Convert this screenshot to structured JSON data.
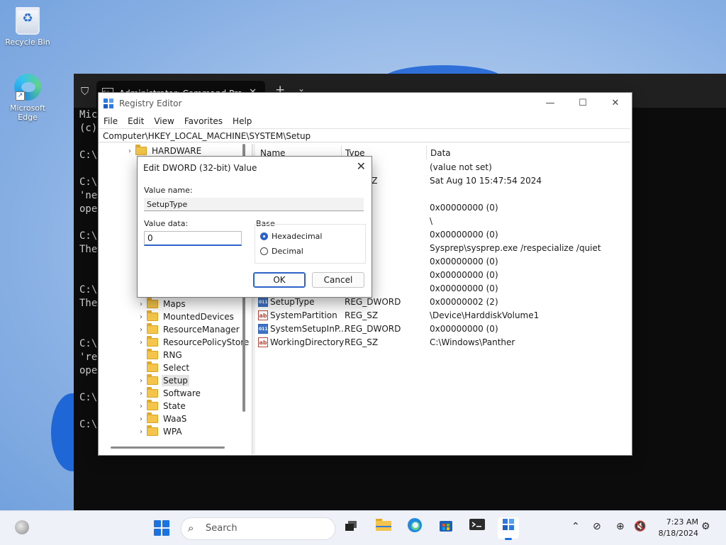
{
  "desktop": {
    "icons": [
      {
        "label": "Recycle Bin"
      },
      {
        "label": "Microsoft Edge"
      }
    ]
  },
  "terminal": {
    "tab_title": "Administrator: Command Pro",
    "lines": [
      {
        "text": "Mic"
      },
      {
        "text": "(c)"
      },
      {
        "text": "C:\\"
      },
      {
        "text": "C:\\"
      },
      {
        "text": "'ne"
      },
      {
        "text": "ope"
      },
      {
        "text": "C:\\"
      },
      {
        "text": "The"
      },
      {
        "text": "C:\\"
      },
      {
        "text": "The"
      },
      {
        "text": "C:\\"
      },
      {
        "text": "'re"
      },
      {
        "text": "ope"
      },
      {
        "text": "C:\\"
      },
      {
        "text": "C:\\"
      }
    ]
  },
  "regedit": {
    "title": "Registry Editor",
    "menu": [
      "File",
      "Edit",
      "View",
      "Favorites",
      "Help"
    ],
    "address": "Computer\\HKEY_LOCAL_MACHINE\\SYSTEM\\Setup",
    "tree": [
      {
        "label": "HARDWARE",
        "chevron": "›"
      },
      {
        "label": "Maps",
        "chevron": "›"
      },
      {
        "label": "MountedDevices",
        "chevron": "›"
      },
      {
        "label": "ResourceManager",
        "chevron": "›"
      },
      {
        "label": "ResourcePolicyStore",
        "chevron": "›"
      },
      {
        "label": "RNG",
        "chevron": ""
      },
      {
        "label": "Select",
        "chevron": ""
      },
      {
        "label": "Setup",
        "chevron": "›"
      },
      {
        "label": "Software",
        "chevron": "›"
      },
      {
        "label": "State",
        "chevron": "›"
      },
      {
        "label": "WaaS",
        "chevron": "›"
      },
      {
        "label": "WPA",
        "chevron": "›"
      }
    ],
    "columns": {
      "name": "Name",
      "type": "Type",
      "data": "Data"
    },
    "values": [
      {
        "name": "",
        "type": "",
        "data": "(value not set)",
        "kind": "sz"
      },
      {
        "name": "",
        "type": "ULTI_SZ",
        "data": "Sat Aug 10 15:47:54 2024",
        "kind": "sz"
      },
      {
        "name": "",
        "type": "",
        "data": "",
        "kind": "sz"
      },
      {
        "name": "",
        "type": "WORD",
        "data": "0x00000000 (0)",
        "kind": "dw"
      },
      {
        "name": "",
        "type": "",
        "data": "\\",
        "kind": "sz"
      },
      {
        "name": "",
        "type": "WORD",
        "data": "0x00000000 (0)",
        "kind": "dw"
      },
      {
        "name": "",
        "type": "",
        "data": "Sysprep\\sysprep.exe /respecialize /quiet",
        "kind": "sz"
      },
      {
        "name": "",
        "type": "WORD",
        "data": "0x00000000 (0)",
        "kind": "dw"
      },
      {
        "name": "",
        "type": "WORD",
        "data": "0x00000000 (0)",
        "kind": "dw"
      },
      {
        "name": "",
        "type": "WORD",
        "data": "0x00000000 (0)",
        "kind": "dw"
      },
      {
        "name": "SetupType",
        "type": "REG_DWORD",
        "data": "0x00000002 (2)",
        "kind": "dw"
      },
      {
        "name": "SystemPartition",
        "type": "REG_SZ",
        "data": "\\Device\\HarddiskVolume1",
        "kind": "sz"
      },
      {
        "name": "SystemSetupInP...",
        "type": "REG_DWORD",
        "data": "0x00000000 (0)",
        "kind": "dw"
      },
      {
        "name": "WorkingDirectory",
        "type": "REG_SZ",
        "data": "C:\\Windows\\Panther",
        "kind": "sz"
      }
    ]
  },
  "dialog": {
    "title": "Edit DWORD (32-bit) Value",
    "value_name_label": "Value name:",
    "value_name": "SetupType",
    "value_data_label": "Value data:",
    "value_data": "0",
    "base_label": "Base",
    "hex_label": "Hexadecimal",
    "dec_label": "Decimal",
    "selected_base": "Hexadecimal",
    "ok_label": "OK",
    "cancel_label": "Cancel"
  },
  "taskbar": {
    "search_placeholder": "Search",
    "apps": [
      "task-view",
      "file-explorer",
      "edge",
      "store",
      "terminal",
      "regedit"
    ],
    "clock_time": "7:23 AM",
    "clock_date": "8/18/2024"
  }
}
